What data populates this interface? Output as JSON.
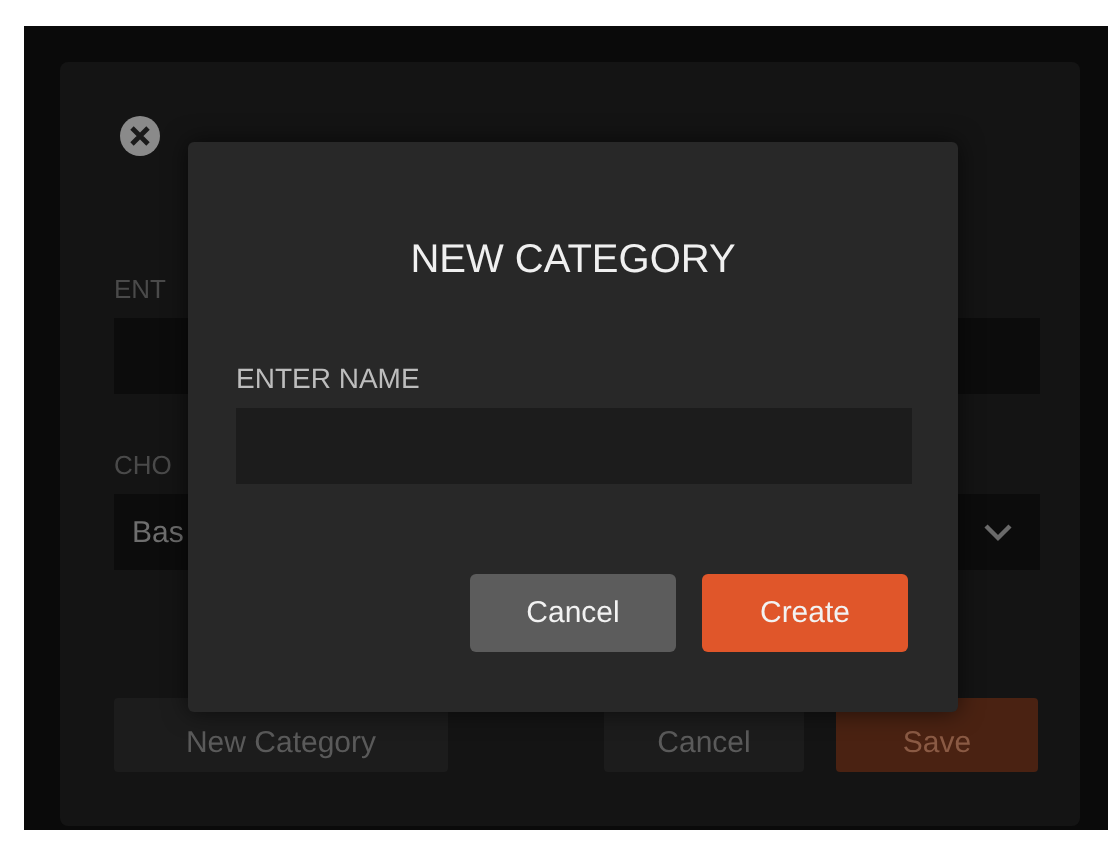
{
  "background_form": {
    "name_label": "ENT",
    "select_label": "CHO",
    "select_value": "Bas",
    "buttons": [
      {
        "label": "New Category",
        "kind": "secondary"
      },
      {
        "label": "Cancel",
        "kind": "secondary"
      },
      {
        "label": "Save",
        "kind": "primary"
      }
    ]
  },
  "dialog": {
    "title": "NEW CATEGORY",
    "field_label": "ENTER NAME",
    "buttons": [
      {
        "label": "Cancel",
        "kind": "secondary"
      },
      {
        "label": "Create",
        "kind": "primary"
      }
    ]
  }
}
